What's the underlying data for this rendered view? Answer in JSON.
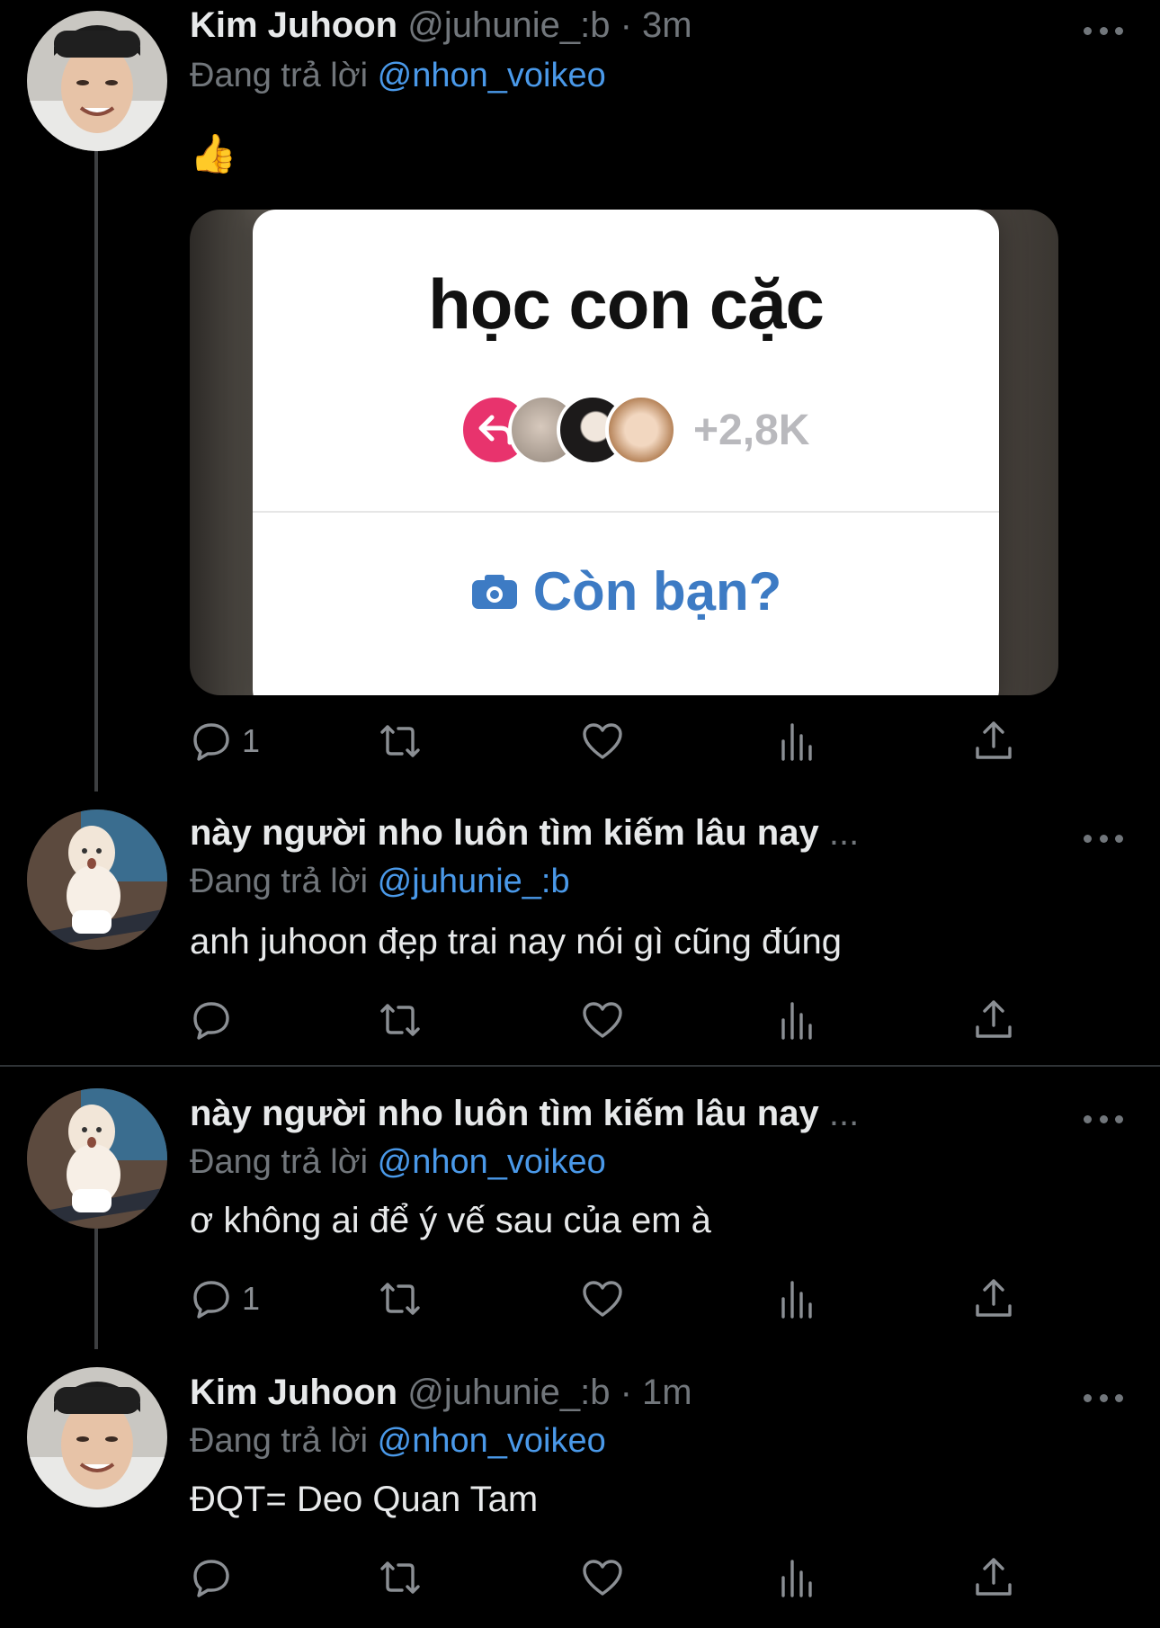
{
  "tweets": [
    {
      "name": "Kim Juhoon",
      "handle": "@juhunie_:b",
      "time": "· 3m",
      "reply_prefix": "Đang trả lời",
      "reply_to": "@nhon_voikeo",
      "text": "👍",
      "avatar": "smiling-man-photo",
      "actions": {
        "reply_count": "1",
        "retweet_count": "",
        "like_count": ""
      }
    },
    {
      "name": "này người nho luôn tìm kiếm lâu nay",
      "name_suffix": "...",
      "reply_prefix": "Đang trả lời",
      "reply_to": "@juhunie_:b",
      "text": "anh juhoon đẹp trai nay nói gì cũng đúng",
      "avatar": "baby-figure-photo",
      "actions": {
        "reply_count": ""
      }
    },
    {
      "name": "này người nho luôn tìm kiếm lâu nay",
      "name_suffix": "...",
      "reply_prefix": "Đang trả lời",
      "reply_to": "@nhon_voikeo",
      "text": "ơ không ai để ý vế sau của em à",
      "avatar": "baby-figure-photo",
      "actions": {
        "reply_count": "1"
      }
    },
    {
      "name": "Kim Juhoon",
      "handle": "@juhunie_:b",
      "time": "· 1m",
      "reply_prefix": "Đang trả lời",
      "reply_to": "@nhon_voikeo",
      "text": "ĐQT= Deo Quan Tam",
      "avatar": "smiling-man-photo",
      "actions": {
        "reply_count": ""
      }
    }
  ],
  "media": {
    "title": "học con cặc",
    "participants_count": "+2,8K",
    "cta": "Còn bạn?"
  },
  "icons": [
    "reply-icon",
    "retweet-icon",
    "like-icon",
    "analytics-icon",
    "share-icon",
    "more-icon",
    "camera-icon"
  ],
  "colors": {
    "background": "#000000",
    "accent": "#4a99e9",
    "muted": "#71767b",
    "text": "#e7e9ea"
  }
}
